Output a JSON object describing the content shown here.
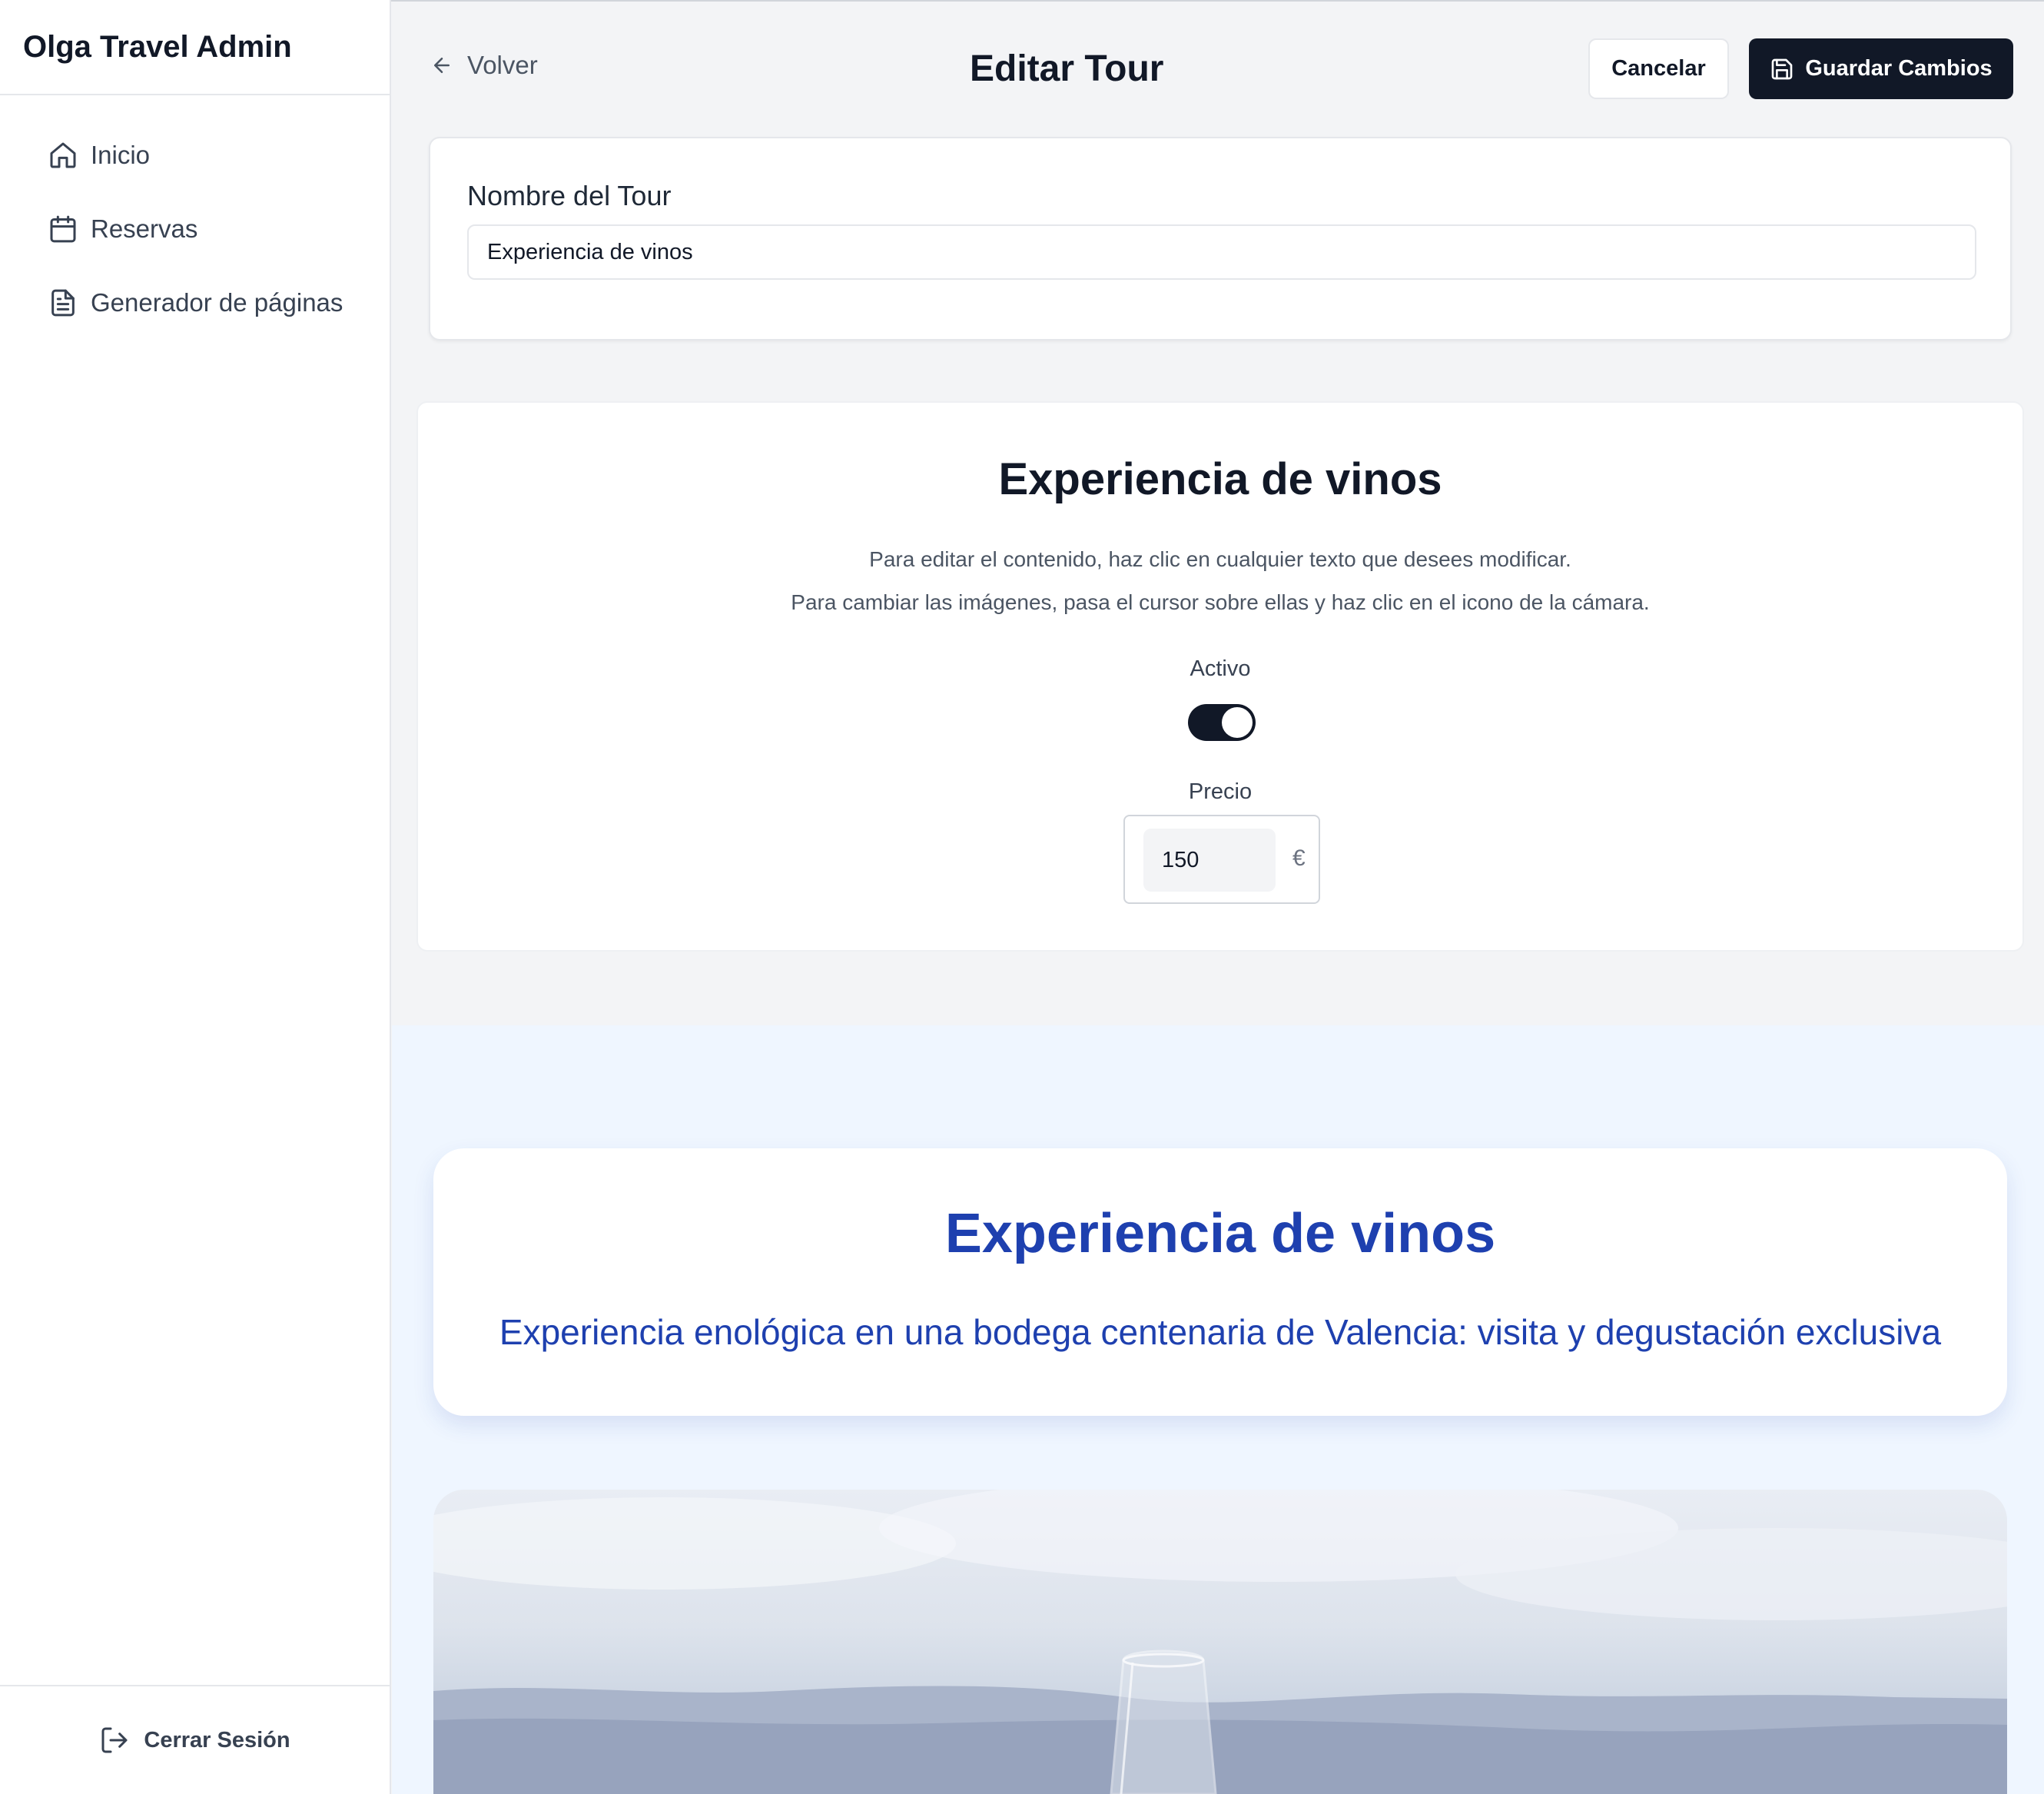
{
  "app": {
    "title": "Olga Travel Admin"
  },
  "sidebar": {
    "items": [
      {
        "label": "Inicio",
        "icon": "home-icon"
      },
      {
        "label": "Reservas",
        "icon": "calendar-icon"
      },
      {
        "label": "Generador de páginas",
        "icon": "file-text-icon"
      }
    ],
    "logout_label": "Cerrar Sesión",
    "logout_icon": "log-out-icon"
  },
  "header": {
    "back_label": "Volver",
    "back_icon": "arrow-left-icon",
    "title": "Editar Tour",
    "cancel_label": "Cancelar",
    "save_label": "Guardar Cambios",
    "save_icon": "save-icon"
  },
  "tour_name": {
    "label": "Nombre del Tour",
    "value": "Experiencia de vinos"
  },
  "settings": {
    "title": "Experiencia de vinos",
    "hint_text": "Para editar el contenido, haz clic en cualquier texto que desees modificar.",
    "hint_images": "Para cambiar las imágenes, pasa el cursor sobre ellas y haz clic en el icono de la cámara.",
    "active_label": "Activo",
    "active": true,
    "price_label": "Precio",
    "price_value": "150",
    "currency": "€"
  },
  "preview": {
    "hero_title": "Experiencia de vinos",
    "hero_subtitle": "Experiencia enológica en una bodega centenaria de Valencia: visita y degustación exclusiva"
  },
  "colors": {
    "primary_dark": "#111827",
    "accent_blue": "#1e40af",
    "preview_bg": "#eff6ff",
    "page_bg": "#f3f4f6"
  }
}
